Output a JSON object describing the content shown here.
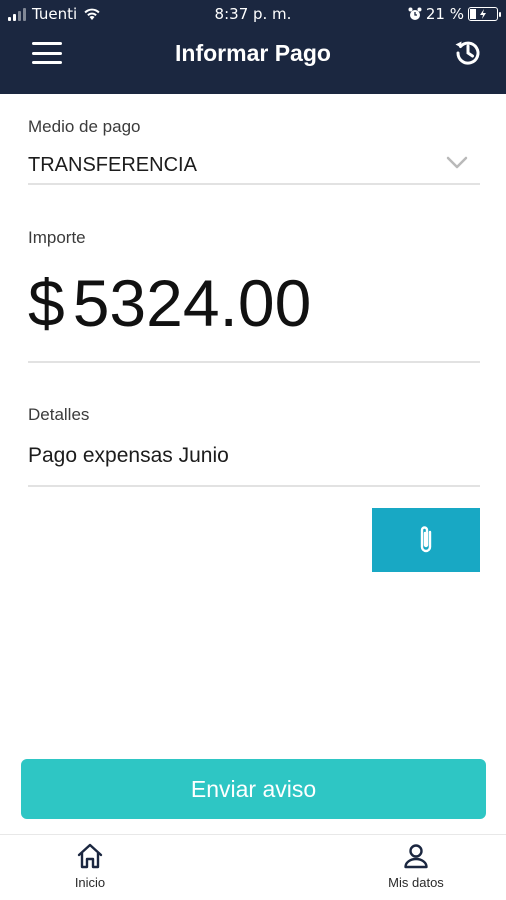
{
  "status_bar": {
    "carrier": "Tuenti",
    "time": "8:37 p. m.",
    "battery": "21 %"
  },
  "header": {
    "title": "Informar Pago"
  },
  "form": {
    "payment_method": {
      "label": "Medio de pago",
      "value": "TRANSFERENCIA"
    },
    "amount": {
      "label": "Importe",
      "currency": "$",
      "value": "5324.00"
    },
    "details": {
      "label": "Detalles",
      "value": "Pago expensas Junio"
    }
  },
  "actions": {
    "send_label": "Enviar aviso"
  },
  "bottom_nav": {
    "items": [
      {
        "label": "Inicio",
        "icon": "home-icon"
      },
      {
        "label": "Mis datos",
        "icon": "user-icon"
      }
    ]
  },
  "colors": {
    "header_bg": "#1b2740",
    "attach_button": "#18a8c4",
    "send_button": "#2ec6c4"
  }
}
